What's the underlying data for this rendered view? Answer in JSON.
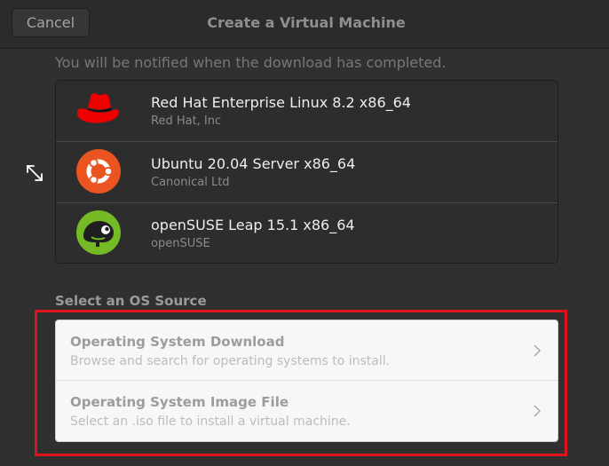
{
  "header": {
    "cancel_label": "Cancel",
    "title": "Create a Virtual Machine"
  },
  "notice": "You will be notified when the download has completed.",
  "os_list": [
    {
      "name": "Red Hat Enterprise Linux 8.2 x86_64",
      "vendor": "Red Hat, Inc",
      "icon": "redhat-logo-icon",
      "color": "#ee0000"
    },
    {
      "name": "Ubuntu 20.04 Server x86_64",
      "vendor": "Canonical Ltd",
      "icon": "ubuntu-logo-icon",
      "color": "#e95420"
    },
    {
      "name": "openSUSE Leap 15.1 x86_64",
      "vendor": "openSUSE",
      "icon": "opensuse-logo-icon",
      "color": "#73ba25"
    }
  ],
  "source_section": {
    "title": "Select an OS Source",
    "items": [
      {
        "title": "Operating System Download",
        "subtitle": "Browse and search for operating systems to install."
      },
      {
        "title": "Operating System Image File",
        "subtitle": "Select an .iso file to install a virtual machine."
      }
    ]
  },
  "colors": {
    "highlight": "#e0121b",
    "background": "#303030"
  }
}
